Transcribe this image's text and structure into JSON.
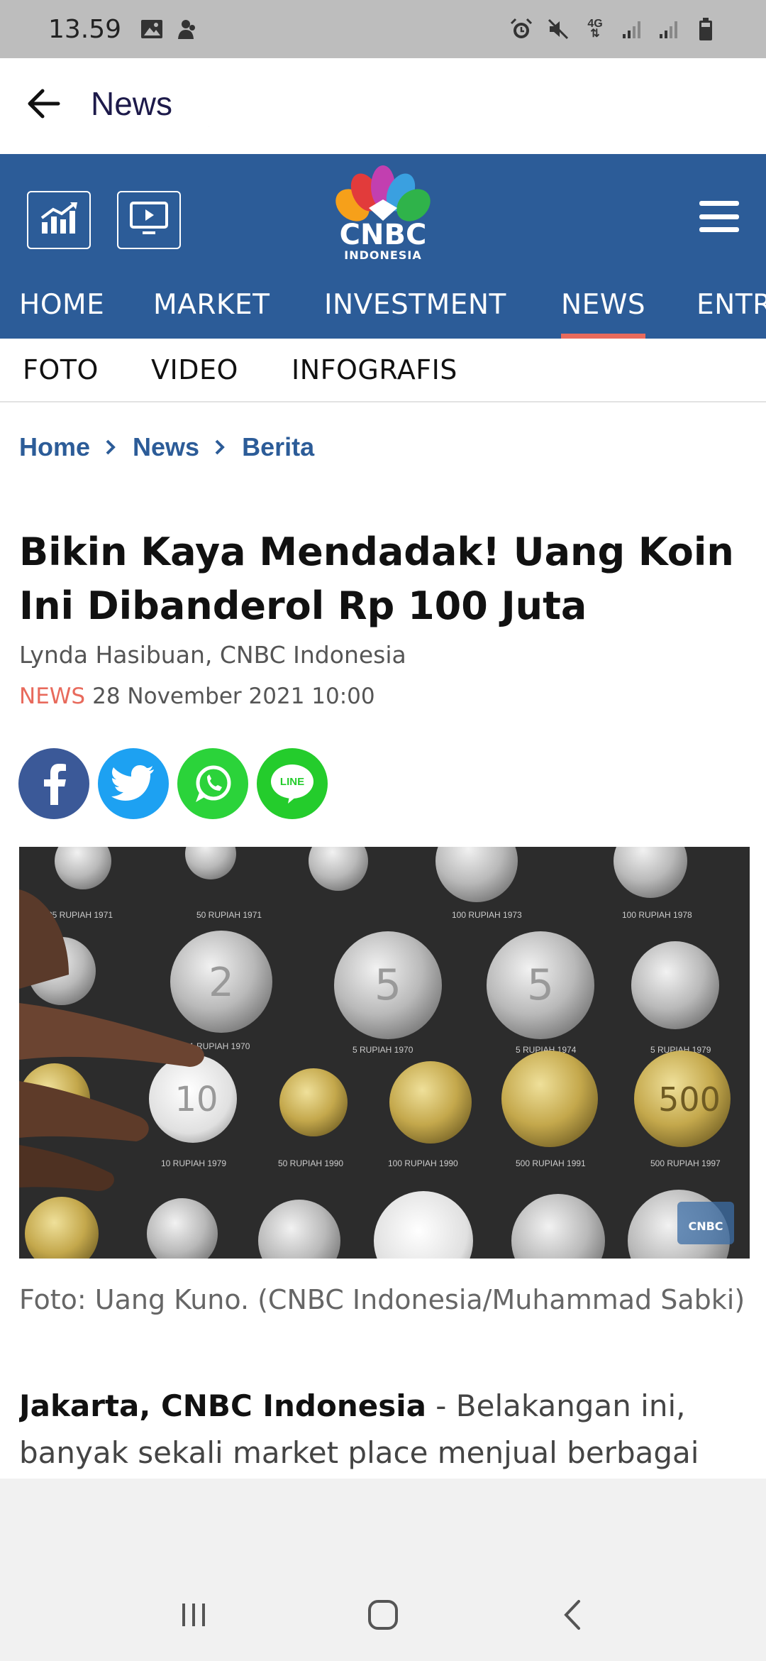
{
  "status_bar": {
    "time": "13.59",
    "network": "4G"
  },
  "app_bar": {
    "title": "News"
  },
  "header": {
    "logo_text": "CNBC",
    "logo_sub": "INDONESIA"
  },
  "main_nav": {
    "items": [
      {
        "label": "HOME"
      },
      {
        "label": "MARKET"
      },
      {
        "label": "INVESTMENT"
      },
      {
        "label": "NEWS"
      },
      {
        "label": "ENTR"
      }
    ],
    "active": "NEWS"
  },
  "sub_nav": {
    "items": [
      {
        "label": "FOTO"
      },
      {
        "label": "VIDEO"
      },
      {
        "label": "INFOGRAFIS"
      }
    ]
  },
  "breadcrumb": {
    "items": [
      "Home",
      "News",
      "Berita"
    ]
  },
  "article": {
    "title": "Bikin Kaya Mendadak! Uang Koin Ini Dibanderol Rp 100 Juta",
    "author": "Lynda Hasibuan, CNBC Indonesia",
    "category": "NEWS",
    "date": "28 November 2021 10:00",
    "caption": "Foto: Uang Kuno. (CNBC Indonesia/Muhammad Sabki)",
    "lead_bold": "Jakarta, CNBC Indonesia",
    "lead_text": " - Belakangan ini, banyak sekali market place menjual berbagai"
  },
  "photo_coins": {
    "row1": [
      "25 RUPIAH 1971",
      "50 RUPIAH 1971",
      "100 RUPIAH 1973",
      "100 RUPIAH 1978"
    ],
    "row2": [
      "1 RUPIAH 1970",
      "5 RUPIAH 1970",
      "5 RUPIAH 1974",
      "5 RUPIAH 1979"
    ],
    "row3": [
      "10 RUPIAH 1979",
      "50 RUPIAH 1990",
      "100 RUPIAH 1990",
      "500 RUPIAH 1991",
      "500 RUPIAH 1997"
    ],
    "big_numbers": [
      "2",
      "5",
      "5",
      "10",
      "500"
    ],
    "watermark": "CNBC"
  },
  "share": [
    "facebook",
    "twitter",
    "whatsapp",
    "line"
  ],
  "share_line_label": "LINE",
  "colors": {
    "brand_blue": "#2c5c98",
    "accent_red": "#e86a5c",
    "facebook": "#3b5998",
    "twitter": "#1da1f2",
    "whatsapp": "#2bd33a",
    "line": "#24cc2c"
  }
}
